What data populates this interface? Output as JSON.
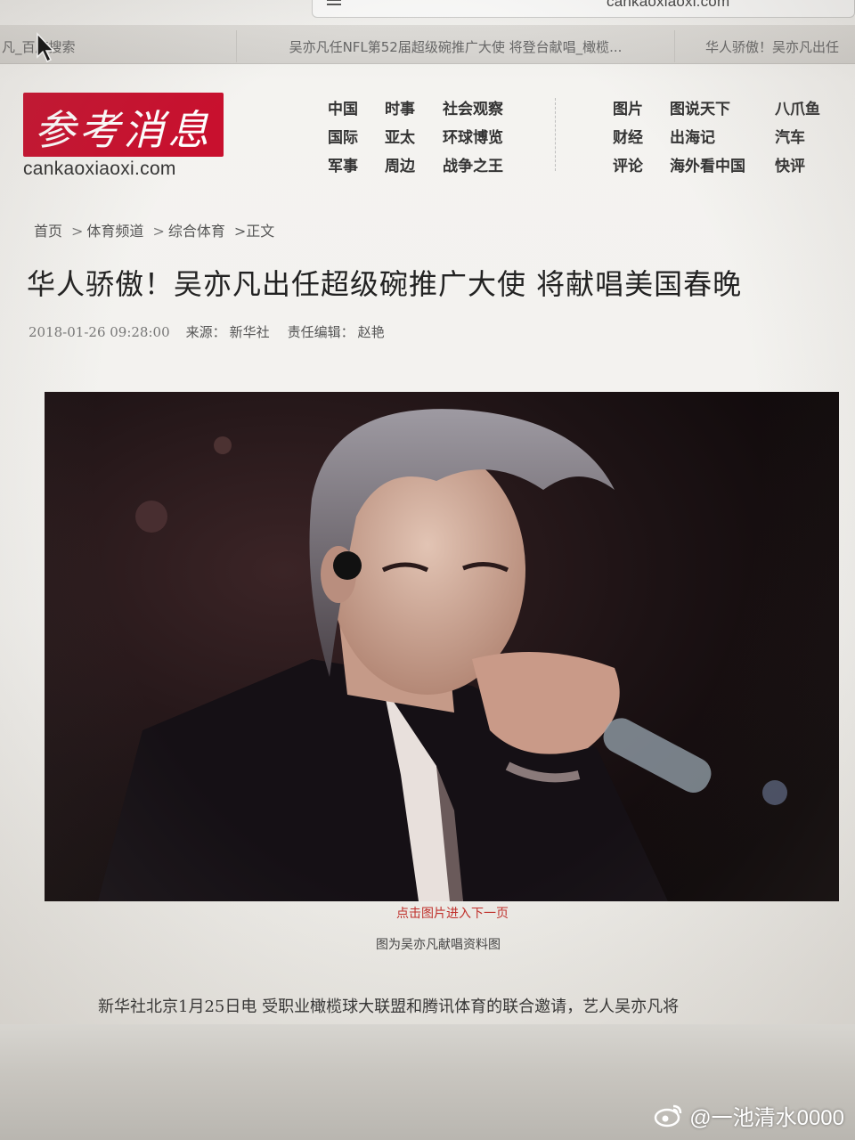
{
  "browser": {
    "address_url": "cankaoxiaoxi.com",
    "tabs": [
      {
        "label": "凡_百度搜索"
      },
      {
        "label": "吴亦凡任NFL第52届超级碗推广大使 将登台献唱_橄榄..."
      },
      {
        "label": "华人骄傲！吴亦凡出任"
      }
    ]
  },
  "header": {
    "logo_text": "参考消息",
    "logo_url": "cankaoxiaoxi.com",
    "nav": [
      {
        "label": "中国"
      },
      {
        "label": "时事"
      },
      {
        "label": "社会观察"
      },
      {
        "label": "国际"
      },
      {
        "label": "亚太"
      },
      {
        "label": "环球博览"
      },
      {
        "label": "军事"
      },
      {
        "label": "周边"
      },
      {
        "label": "战争之王"
      },
      {
        "label": "图片"
      },
      {
        "label": "图说天下"
      },
      {
        "label": "八爪鱼"
      },
      {
        "label": "财经"
      },
      {
        "label": "出海记"
      },
      {
        "label": "汽车"
      },
      {
        "label": "评论"
      },
      {
        "label": "海外看中国"
      },
      {
        "label": "快评"
      }
    ]
  },
  "breadcrumb": {
    "home": "首页",
    "sep": ">",
    "channel": "体育频道",
    "section": "综合体育",
    "current": ">正文"
  },
  "article": {
    "title": "华人骄傲！吴亦凡出任超级碗推广大使 将献唱美国春晚",
    "date": "2018-01-26 09:28:00",
    "source_label": "来源：",
    "source": "新华社",
    "editor_label": "责任编辑：",
    "editor": "赵艳",
    "photo_link": "点击图片进入下一页",
    "photo_caption": "图为吴亦凡献唱资料图",
    "body_first_line": "新华社北京1月25日电 受职业橄榄球大联盟和腾讯体育的联合邀请，艺人吴亦凡将"
  },
  "watermark": {
    "text": "@一池清水0000",
    "icon": "weibo-icon"
  },
  "colors": {
    "logo_red": "#c8102e",
    "link_red": "#c0302b"
  }
}
